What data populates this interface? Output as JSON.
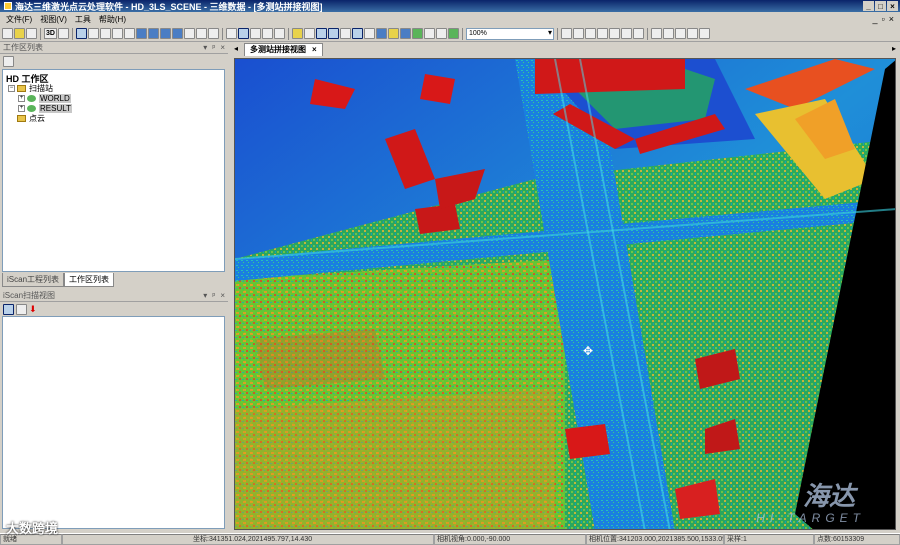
{
  "window": {
    "title": "海达三维激光点云处理软件 - HD_3LS_SCENE - 三维数据 - [多测站拼接视图]"
  },
  "menu": [
    "文件(F)",
    "视图(V)",
    "工具",
    "帮助(H)"
  ],
  "toolbar": {
    "mode_3d": "3D",
    "zoom": "100%"
  },
  "workspace_panel": {
    "title": "工作区列表",
    "root": "HD 工作区",
    "scan_station": "扫描站",
    "items": [
      "WORLD",
      "RESULT"
    ],
    "point_cloud": "点云"
  },
  "panel_tabs": [
    "iScan工程列表",
    "工作区列表"
  ],
  "scan_view_panel": {
    "title": "iScan扫描视图"
  },
  "view": {
    "tab_label": "多测站拼接视图",
    "watermark": "海达",
    "watermark_sub": "HI-TARGET"
  },
  "status": {
    "ready": "就绪",
    "coords": "坐标:341351.024,2021495.797,14.430",
    "camera_angle": "相机视角:0.000,-90.000",
    "camera_pos": "相机位置:341203.000,2021385.500,1533.095",
    "sample": "采样:1",
    "points": "点数:60153309"
  },
  "overlay_watermark": "大数跨境",
  "colors": {
    "title_bar": "#0a246a",
    "canvas_bg": "#0a2aa0"
  }
}
